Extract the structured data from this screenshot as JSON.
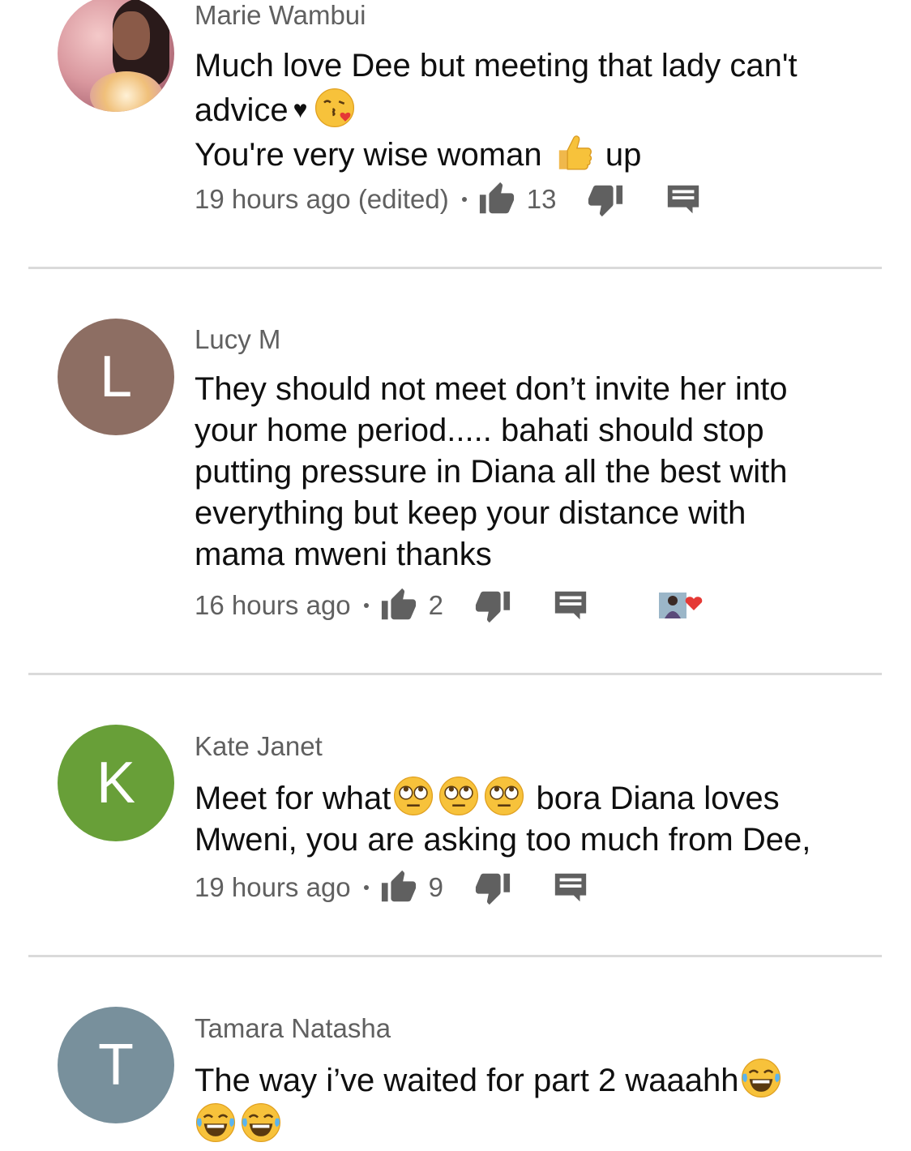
{
  "comments": [
    {
      "author": "Marie Wambui",
      "avatar_letter": "",
      "avatar_color": "#d9979e",
      "lines": [
        {
          "a": "Much love Dee but meeting that lady can't"
        },
        {
          "a": "advice",
          "b": "♥"
        },
        {
          "a": "You're very wise woman",
          "b": "up"
        }
      ],
      "time": "19 hours ago (edited)",
      "likes": "13"
    },
    {
      "author": "Lucy M",
      "avatar_letter": "L",
      "avatar_color": "#8d6e63",
      "lines": [
        {
          "a": "They should not meet don’t invite her into"
        },
        {
          "a": "your home period..... bahati should stop"
        },
        {
          "a": "putting pressure in Diana all the best with"
        },
        {
          "a": "everything but keep your distance with"
        },
        {
          "a": "mama mweni thanks"
        }
      ],
      "time": "16 hours ago",
      "likes": "2"
    },
    {
      "author": "Kate Janet",
      "avatar_letter": "K",
      "avatar_color": "#689f38",
      "lines": [
        {
          "a": "Meet for what",
          "b": "bora Diana loves"
        },
        {
          "a": "Mweni, you are asking too much from Dee,"
        }
      ],
      "time": "19 hours ago",
      "likes": "9"
    },
    {
      "author": "Tamara Natasha",
      "avatar_letter": "T",
      "avatar_color": "#78909c",
      "lines": [
        {
          "a": "The way i’ve waited for part 2 waaahh"
        }
      ]
    }
  ],
  "icons": {
    "like": "thumbs-up-icon",
    "dislike": "thumbs-down-icon",
    "reply": "reply-comment-icon",
    "creator_heart": "creator-heart-icon",
    "kissing": "face-blowing-kiss-emoji",
    "thumbs": "thumbs-up-emoji",
    "rolling_eyes": "face-with-rolling-eyes-emoji",
    "laughing": "face-with-tears-of-joy-emoji"
  },
  "colors": {
    "secondary_text": "#606060",
    "primary_text": "#0f0f0f",
    "divider": "#dadada",
    "creator_heart": "#e53935"
  }
}
